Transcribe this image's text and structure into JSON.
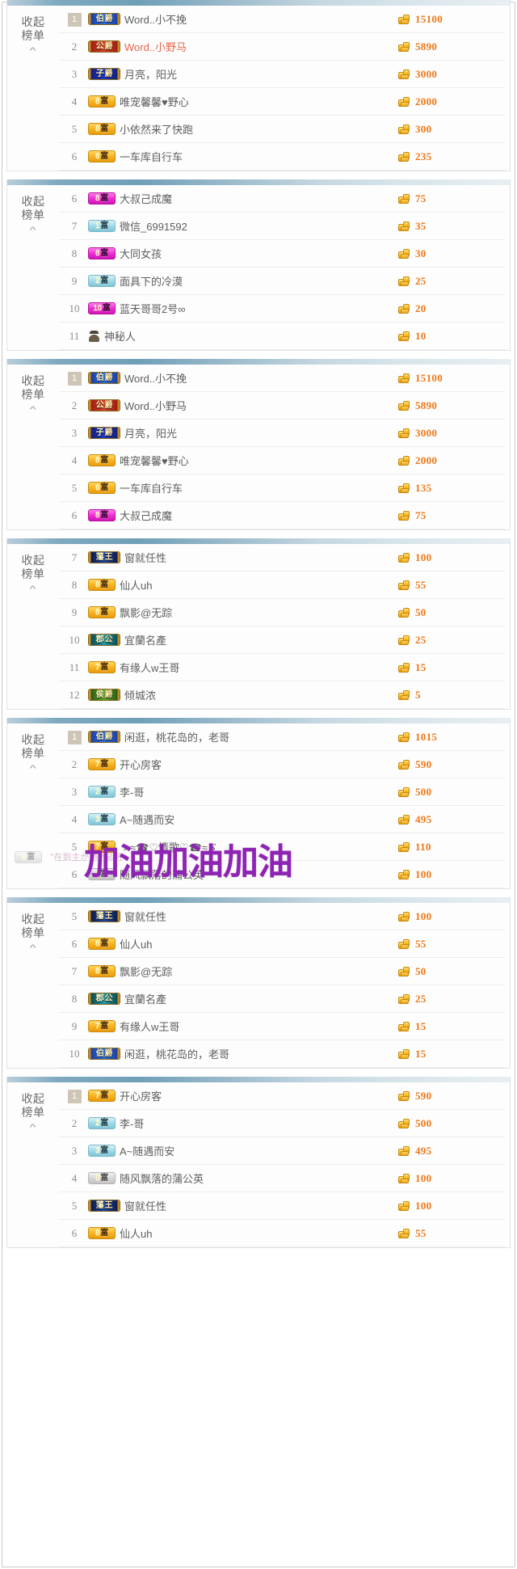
{
  "collapse": {
    "line1": "收起",
    "line2": "榜单",
    "caret": "^"
  },
  "overlay": {
    "text": "加油加油加油",
    "color": "#8e24b3"
  },
  "ghost": {
    "badge_lv": "8",
    "badge_suffix": "富",
    "text": "°在到主が诗♂易可"
  },
  "icons": {
    "coin": "coin-stack-icon",
    "mystery": "mystery-person-icon"
  },
  "panels": [
    {
      "id": "panel-1",
      "rows": [
        {
          "rank": "1",
          "top": true,
          "badge": {
            "lv": "伯",
            "suffix": "爵",
            "style": "noble blue"
          },
          "name": "Word..小不挽",
          "score": "15100"
        },
        {
          "rank": "2",
          "top": false,
          "badge": {
            "lv": "公",
            "suffix": "爵",
            "style": "noble red"
          },
          "name": "Word..小野马",
          "name_hl": true,
          "score": "5890"
        },
        {
          "rank": "3",
          "top": false,
          "badge": {
            "lv": "子",
            "suffix": "爵",
            "style": "noble indigo"
          },
          "name": "月亮，阳光",
          "score": "3000"
        },
        {
          "rank": "4",
          "top": false,
          "badge": {
            "lv": "8",
            "suffix": "富",
            "style": "gold"
          },
          "name": "唯宠馨馨♥野心",
          "score": "2000"
        },
        {
          "rank": "5",
          "top": false,
          "badge": {
            "lv": "8",
            "suffix": "富",
            "style": "gold"
          },
          "name": "小依然来了快跑",
          "score": "300"
        },
        {
          "rank": "6",
          "top": false,
          "badge": {
            "lv": "6",
            "suffix": "富",
            "style": "gold"
          },
          "name": "一车库自行车",
          "score": "235"
        }
      ]
    },
    {
      "id": "panel-2",
      "rows": [
        {
          "rank": "6",
          "top": false,
          "badge": {
            "lv": "8",
            "suffix": "富",
            "style": "magenta"
          },
          "name": "大叔己成魔",
          "score": "75"
        },
        {
          "rank": "7",
          "top": false,
          "badge": {
            "lv": "1",
            "suffix": "富",
            "style": "cyan"
          },
          "name": "微信_6991592",
          "score": "35"
        },
        {
          "rank": "8",
          "top": false,
          "badge": {
            "lv": "8",
            "suffix": "富",
            "style": "magenta"
          },
          "name": "大同女孩",
          "score": "30"
        },
        {
          "rank": "9",
          "top": false,
          "badge": {
            "lv": "2",
            "suffix": "富",
            "style": "cyan"
          },
          "name": "面具下的冷漠",
          "score": "25"
        },
        {
          "rank": "10",
          "top": false,
          "badge": {
            "lv": "10",
            "suffix": "富",
            "style": "magenta"
          },
          "name": "蓝天哥哥2号∞",
          "score": "20"
        },
        {
          "rank": "11",
          "top": false,
          "mystery": true,
          "name": "神秘人",
          "score": "10"
        }
      ]
    },
    {
      "id": "panel-3",
      "rows": [
        {
          "rank": "1",
          "top": true,
          "badge": {
            "lv": "伯",
            "suffix": "爵",
            "style": "noble blue"
          },
          "name": "Word..小不挽",
          "score": "15100"
        },
        {
          "rank": "2",
          "top": false,
          "badge": {
            "lv": "公",
            "suffix": "爵",
            "style": "noble red"
          },
          "name": "Word..小野马",
          "score": "5890"
        },
        {
          "rank": "3",
          "top": false,
          "badge": {
            "lv": "子",
            "suffix": "爵",
            "style": "noble indigo"
          },
          "name": "月亮，阳光",
          "score": "3000"
        },
        {
          "rank": "4",
          "top": false,
          "badge": {
            "lv": "8",
            "suffix": "富",
            "style": "gold"
          },
          "name": "唯宠馨馨♥野心",
          "score": "2000"
        },
        {
          "rank": "5",
          "top": false,
          "badge": {
            "lv": "6",
            "suffix": "富",
            "style": "gold"
          },
          "name": "一车库自行车",
          "score": "135"
        },
        {
          "rank": "6",
          "top": false,
          "badge": {
            "lv": "8",
            "suffix": "富",
            "style": "magenta"
          },
          "name": "大叔己成魔",
          "score": "75"
        }
      ]
    },
    {
      "id": "panel-4",
      "rows": [
        {
          "rank": "7",
          "top": false,
          "badge": {
            "lv": "藩",
            "suffix": "王",
            "style": "noble navy"
          },
          "name": "窗就任性",
          "score": "100"
        },
        {
          "rank": "8",
          "top": false,
          "badge": {
            "lv": "8",
            "suffix": "富",
            "style": "gold"
          },
          "name": "仙人uh",
          "score": "55"
        },
        {
          "rank": "9",
          "top": false,
          "badge": {
            "lv": "8",
            "suffix": "富",
            "style": "gold"
          },
          "name": "飘影@无踪",
          "score": "50"
        },
        {
          "rank": "10",
          "top": false,
          "badge": {
            "lv": "郡",
            "suffix": "公",
            "style": "noble teal"
          },
          "name": "宜蘭名產",
          "score": "25"
        },
        {
          "rank": "11",
          "top": false,
          "badge": {
            "lv": "7",
            "suffix": "富",
            "style": "gold"
          },
          "name": "有缘人w王哥",
          "score": "15"
        },
        {
          "rank": "12",
          "top": false,
          "badge": {
            "lv": "侯",
            "suffix": "爵",
            "style": "noble green"
          },
          "name": "倾城浓",
          "score": "5"
        }
      ]
    },
    {
      "id": "panel-5",
      "rows": [
        {
          "rank": "1",
          "top": true,
          "badge": {
            "lv": "伯",
            "suffix": "爵",
            "style": "noble blue"
          },
          "name": "闲逛，桃花岛的，老哥",
          "score": "1015"
        },
        {
          "rank": "2",
          "top": false,
          "badge": {
            "lv": "7",
            "suffix": "富",
            "style": "gold"
          },
          "name": "开心房客",
          "score": "590"
        },
        {
          "rank": "3",
          "top": false,
          "badge": {
            "lv": "2",
            "suffix": "富",
            "style": "cyan"
          },
          "name": "李-哥",
          "score": "500"
        },
        {
          "rank": "4",
          "top": false,
          "badge": {
            "lv": "3",
            "suffix": "富",
            "style": "cyan"
          },
          "name": "A~随遇而安",
          "score": "495"
        },
        {
          "rank": "5",
          "top": false,
          "badge": {
            "lv": "7",
            "suffix": "富",
            "style": "gold"
          },
          "name": "ゝ≈☎♡情歌♡☎≈ゞ",
          "score": "110"
        },
        {
          "rank": "6",
          "top": false,
          "badge": {
            "lv": "0",
            "suffix": "富",
            "style": "grey"
          },
          "name": "随风飘落的蒲公英",
          "score": "100"
        }
      ]
    },
    {
      "id": "panel-6",
      "rows": [
        {
          "rank": "5",
          "top": false,
          "badge": {
            "lv": "藩",
            "suffix": "王",
            "style": "noble navy"
          },
          "name": "窗就任性",
          "score": "100"
        },
        {
          "rank": "6",
          "top": false,
          "badge": {
            "lv": "8",
            "suffix": "富",
            "style": "gold"
          },
          "name": "仙人uh",
          "score": "55"
        },
        {
          "rank": "7",
          "top": false,
          "badge": {
            "lv": "8",
            "suffix": "富",
            "style": "gold"
          },
          "name": "飘影@无踪",
          "score": "50"
        },
        {
          "rank": "8",
          "top": false,
          "badge": {
            "lv": "郡",
            "suffix": "公",
            "style": "noble teal"
          },
          "name": "宜蘭名產",
          "score": "25"
        },
        {
          "rank": "9",
          "top": false,
          "badge": {
            "lv": "7",
            "suffix": "富",
            "style": "gold"
          },
          "name": "有缘人w王哥",
          "score": "15"
        },
        {
          "rank": "10",
          "top": false,
          "badge": {
            "lv": "伯",
            "suffix": "爵",
            "style": "noble blue"
          },
          "name": "闲逛，桃花岛的，老哥",
          "score": "15"
        }
      ]
    },
    {
      "id": "panel-7",
      "rows": [
        {
          "rank": "1",
          "top": true,
          "badge": {
            "lv": "7",
            "suffix": "富",
            "style": "gold"
          },
          "name": "开心房客",
          "score": "590"
        },
        {
          "rank": "2",
          "top": false,
          "badge": {
            "lv": "2",
            "suffix": "富",
            "style": "cyan"
          },
          "name": "李-哥",
          "score": "500"
        },
        {
          "rank": "3",
          "top": false,
          "badge": {
            "lv": "3",
            "suffix": "富",
            "style": "cyan"
          },
          "name": "A~随遇而安",
          "score": "495"
        },
        {
          "rank": "4",
          "top": false,
          "badge": {
            "lv": "0",
            "suffix": "富",
            "style": "grey"
          },
          "name": "随风飘落的蒲公英",
          "score": "100"
        },
        {
          "rank": "5",
          "top": false,
          "badge": {
            "lv": "藩",
            "suffix": "王",
            "style": "noble navy"
          },
          "name": "窗就任性",
          "score": "100"
        },
        {
          "rank": "6",
          "top": false,
          "badge": {
            "lv": "8",
            "suffix": "富",
            "style": "gold"
          },
          "name": "仙人uh",
          "score": "55"
        }
      ]
    }
  ]
}
